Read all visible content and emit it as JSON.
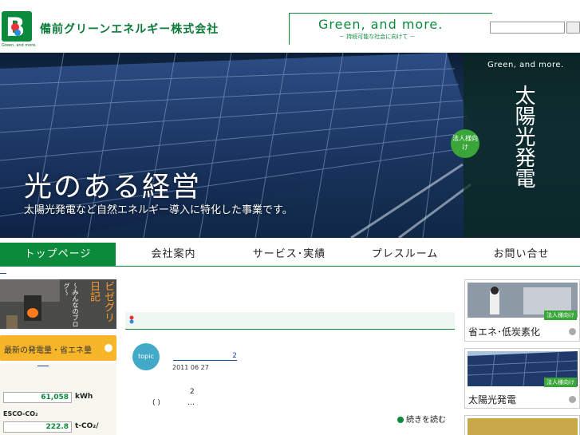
{
  "header": {
    "logo_letter": "B",
    "logo_sub": "Green, and more.",
    "company_name": "備前グリーンエネルギー株式会社",
    "tagline": "Green, and more.",
    "tagline_sub": "－ 持続可能な社会に向けて －",
    "search_placeholder": ""
  },
  "hero": {
    "title": "光のある経営",
    "subtitle": "太陽光発電など自然エネルギー導入に特化した事業です。",
    "side_en": "Green, and more.",
    "side_title": "太陽光発電",
    "badge": "法人様向け"
  },
  "nav": {
    "items": [
      {
        "label": "トップページ",
        "active": true
      },
      {
        "label": "会社案内",
        "active": false
      },
      {
        "label": "サービス･実績",
        "active": false
      },
      {
        "label": "プレスルーム",
        "active": false
      },
      {
        "label": "お問い合せ",
        "active": false
      }
    ]
  },
  "left": {
    "blog_title": "ビゼグリ日記",
    "blog_sub": "～みんなのブログ～",
    "power_label": "最新の発電量・省エネ量",
    "meter1_value": "61,058",
    "meter1_unit": "kWh",
    "esco_label": "ESCO-CO₂",
    "meter2_value": "222.8",
    "meter2_unit": "t-CO₂/"
  },
  "main": {
    "topic_badge": "topic",
    "topic_link": "2",
    "topic_date": "2011 06 27",
    "topic_num": "2",
    "topic_paren": "( )",
    "topic_ellipsis": "…",
    "read_more": "続きを読む"
  },
  "right": {
    "cards": [
      {
        "label": "省エネ･低炭素化",
        "badge": "法人様向け"
      },
      {
        "label": "太陽光発電",
        "badge": "法人様向け"
      }
    ]
  },
  "colors": {
    "brand_green": "#0a8a3a",
    "accent_orange": "#f7b52a",
    "topic_blue": "#43a9c9"
  }
}
